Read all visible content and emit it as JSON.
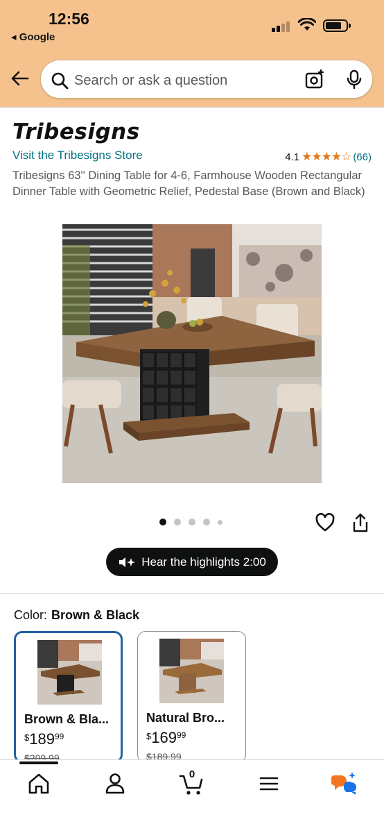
{
  "status": {
    "time": "12:56",
    "back_app": "◂ Google"
  },
  "search": {
    "placeholder": "Search or ask a question"
  },
  "product": {
    "brand_logo": "Tribesigns",
    "store_link": "Visit the Tribesigns Store",
    "rating_value": "4.1",
    "stars": "★★★★☆",
    "rating_count": "(66)",
    "title": "Tribesigns 63'' Dining Table for 4-6, Farmhouse Wooden Rectangular Dinner Table with Geometric Relief, Pedestal Base (Brown and Black)",
    "image_count": 5,
    "active_image": 1
  },
  "audio": {
    "label": "Hear the highlights 2:00"
  },
  "color": {
    "label": "Color:",
    "selected": "Brown & Black"
  },
  "variants": [
    {
      "name": "Brown & Bla...",
      "currency": "$",
      "price_whole": "189",
      "price_cents": "99",
      "old_price": "$209.99"
    },
    {
      "name": "Natural Bro...",
      "currency": "$",
      "price_whole": "169",
      "price_cents": "99",
      "old_price": "$189.99"
    }
  ],
  "cart": {
    "count": "0"
  },
  "colors": {
    "header_bg": "#f5c28d",
    "link": "#007185",
    "star": "#de7921",
    "selected_border": "#2162a1"
  }
}
